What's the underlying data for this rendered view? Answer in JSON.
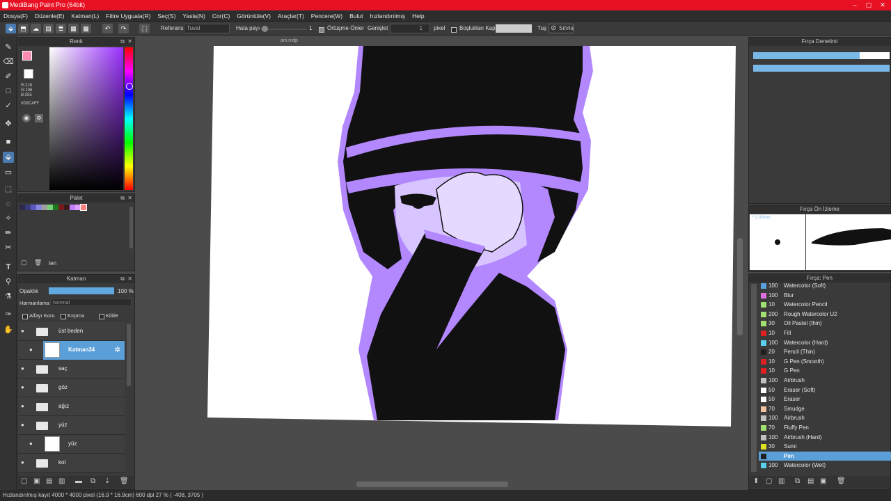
{
  "title": "MediBang Paint Pro (64bit)",
  "menu": [
    "Dosya(F)",
    "Düzenle(E)",
    "Katman(L)",
    "Filtre Uyguala(R)",
    "Seç(S)",
    "Yasla(N)",
    "Cor(C)",
    "Görüntüle(V)",
    "Araçlar(T)",
    "Pencere(W)",
    "Bulut",
    "hızlandırılmış",
    "Help"
  ],
  "toolbar": {
    "referans_label": "Referans",
    "referans_value": "Tuval",
    "hata_label": "Hata payı",
    "hata_value": "1",
    "ortusme_label": "Örtüşme-Önler",
    "genislet_label": "Genişlet",
    "genislet_value": "1",
    "pixel_label": "pixel",
    "bosluk_label": "Boşlukları Kapat",
    "tus_label": "Tuş",
    "sifirla_label": "Sıfırla"
  },
  "color_panel": {
    "title": "Renk",
    "r": "R:216",
    "g": "G:196",
    "b": "B:255",
    "hex": "#D8C4FF",
    "accent": "#d8c4ff"
  },
  "palette_panel": {
    "title": "Palet",
    "palette_name": "ten",
    "swatches": [
      "#2a2a4a",
      "#3a3a7a",
      "#5a5ac0",
      "#8888e0",
      "#a0a0a0",
      "#7ad07a",
      "#1a7a1a",
      "#7a1a1a",
      "#3a1a1a",
      "#c080ff",
      "#e0a0ff",
      "#ff8080"
    ]
  },
  "layer_panel": {
    "title": "Katman",
    "opacity_label": "Opaklık",
    "opacity_value": "100 %",
    "opacity_fraction": 1.0,
    "blend_label": "Harmanlama",
    "blend_value": "Normal",
    "alpha_label": "Alfayı Koru",
    "clip_label": "Kırpma",
    "lock_label": "Kilitle",
    "layers": [
      {
        "name": "üst beden",
        "type": "folder"
      },
      {
        "name": "Katman34",
        "type": "layer",
        "selected": true
      },
      {
        "name": "saç",
        "type": "folder"
      },
      {
        "name": "göz",
        "type": "folder"
      },
      {
        "name": "ağız",
        "type": "folder"
      },
      {
        "name": "yüz",
        "type": "folder"
      },
      {
        "name": "yüz",
        "type": "layer"
      },
      {
        "name": "kol",
        "type": "folder"
      }
    ]
  },
  "canvas": {
    "tab_name": "ani.mdp"
  },
  "brush_control": {
    "title": "Fırça Denetimi",
    "bar1_fraction": 0.78,
    "bar2_fraction": 1.0
  },
  "brush_preview": {
    "title": "Fırça Ön İzleme",
    "size_label": "* 2.00mm"
  },
  "brush_list": {
    "title": "Fırça: Pen",
    "items": [
      {
        "size": "100",
        "name": "Watercolor (Soft)",
        "color": "#5aa0e0"
      },
      {
        "size": "100",
        "name": "Blur",
        "color": "#e070e0"
      },
      {
        "size": "10",
        "name": "Watercolor Pencil",
        "color": "#a0e070"
      },
      {
        "size": "200",
        "name": "Rough Watercolor U2",
        "color": "#a0e070"
      },
      {
        "size": "30",
        "name": "Oil Pastel (thin)",
        "color": "#a0e070"
      },
      {
        "size": "10",
        "name": "Fill",
        "color": "#e02020"
      },
      {
        "size": "100",
        "name": "Watercolor (Hard)",
        "color": "#5ad0f0"
      },
      {
        "size": "20",
        "name": "Pencil (Thin)",
        "color": "#202020"
      },
      {
        "size": "10",
        "name": "G Pen (Smooth)",
        "color": "#e02020"
      },
      {
        "size": "10",
        "name": "G Pen",
        "color": "#e02020"
      },
      {
        "size": "100",
        "name": "Airbrush",
        "color": "#c0c0c0"
      },
      {
        "size": "50",
        "name": "Eraser (Soft)",
        "color": "#ffffff"
      },
      {
        "size": "50",
        "name": "Eraser",
        "color": "#ffffff"
      },
      {
        "size": "70",
        "name": "Smudge",
        "color": "#f0c0a0"
      },
      {
        "size": "100",
        "name": "Airbrush",
        "color": "#c0c0c0"
      },
      {
        "size": "70",
        "name": "Fluffy Pen",
        "color": "#a0e070"
      },
      {
        "size": "100",
        "name": "Airbrush (Hard)",
        "color": "#c0c0c0"
      },
      {
        "size": "30",
        "name": "Sumi",
        "color": "#e0e020"
      },
      {
        "size": "",
        "name": "Pen",
        "color": "#202020",
        "selected": true
      },
      {
        "size": "100",
        "name": "Watercolor (Wet)",
        "color": "#5ad0f0"
      }
    ]
  },
  "status": {
    "text": "Hızlandırılmış kayıt  4000 * 4000 pixel  (16.9 * 16.9cm)  600 dpi  27 %  ( -408, 3705 )"
  }
}
